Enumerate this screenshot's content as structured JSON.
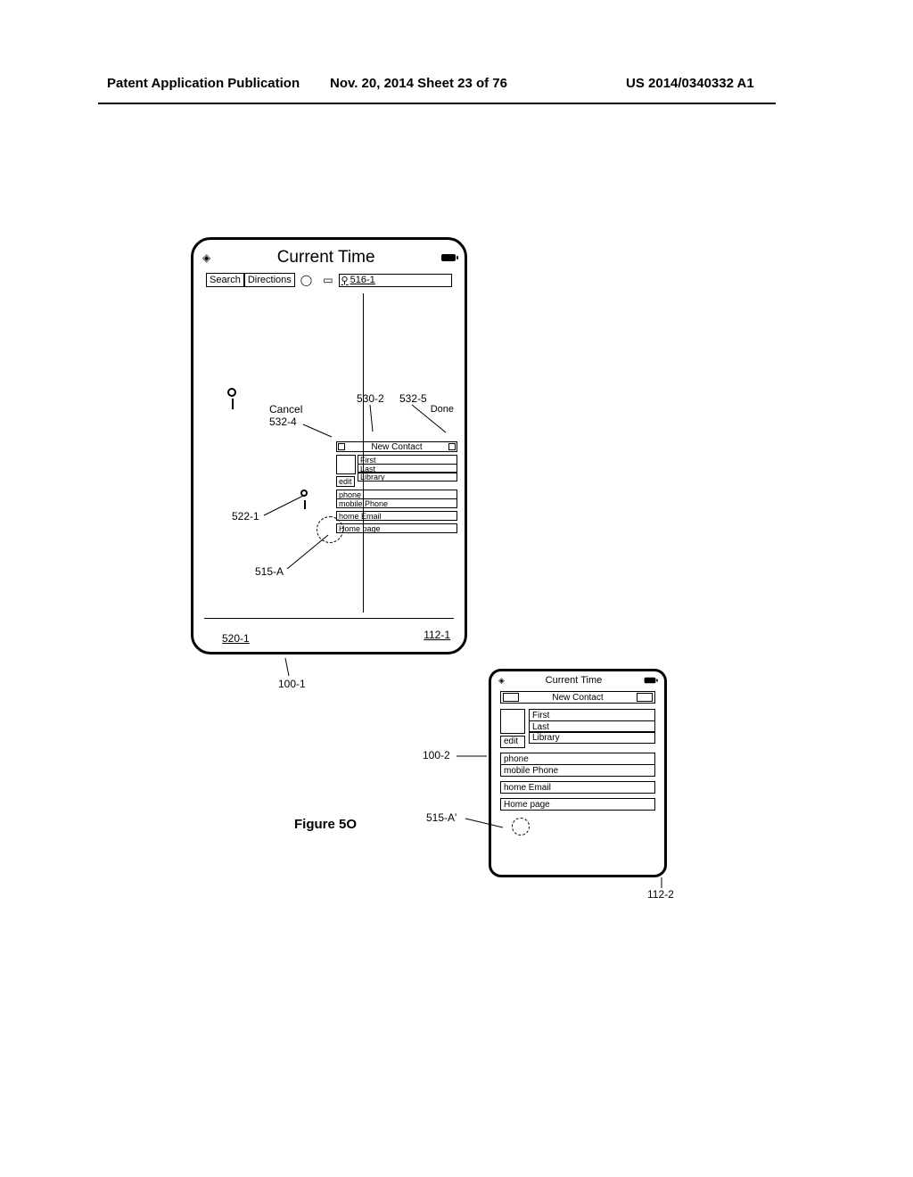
{
  "header": {
    "left": "Patent Application Publication",
    "mid": "Nov. 20, 2014  Sheet 23 of 76",
    "right": "US 2014/0340332 A1"
  },
  "phone1": {
    "title": "Current Time",
    "toolbar": {
      "search": "Search",
      "directions": "Directions",
      "search_ref": "516-1"
    },
    "labels": {
      "cancel": "Cancel",
      "done": "Done",
      "c_532_4": "532-4",
      "c_530_2": "530-2",
      "c_532_5": "532-5",
      "c_522_1": "522-1",
      "c_515_A": "515-A",
      "c_520_1": "520-1",
      "c_112_1": "112-1",
      "c_100_1": "100-1"
    },
    "popup": {
      "new_contact": "New Contact",
      "first": "First",
      "last": "Last",
      "library": "Library",
      "edit": "edit",
      "phone": "phone",
      "mobile": "mobile Phone",
      "email": "home Email",
      "homepage": "Home page"
    }
  },
  "phone2": {
    "title": "Current Time",
    "new_contact": "New Contact",
    "first": "First",
    "last": "Last",
    "library": "Library",
    "edit": "edit",
    "phone": "phone",
    "mobile": "mobile Phone",
    "email": "home Email",
    "homepage": "Home page",
    "labels": {
      "c_100_2": "100-2",
      "c_515_A2": "515-A'",
      "c_112_2": "112-2"
    }
  },
  "figure_caption": "Figure 5O"
}
